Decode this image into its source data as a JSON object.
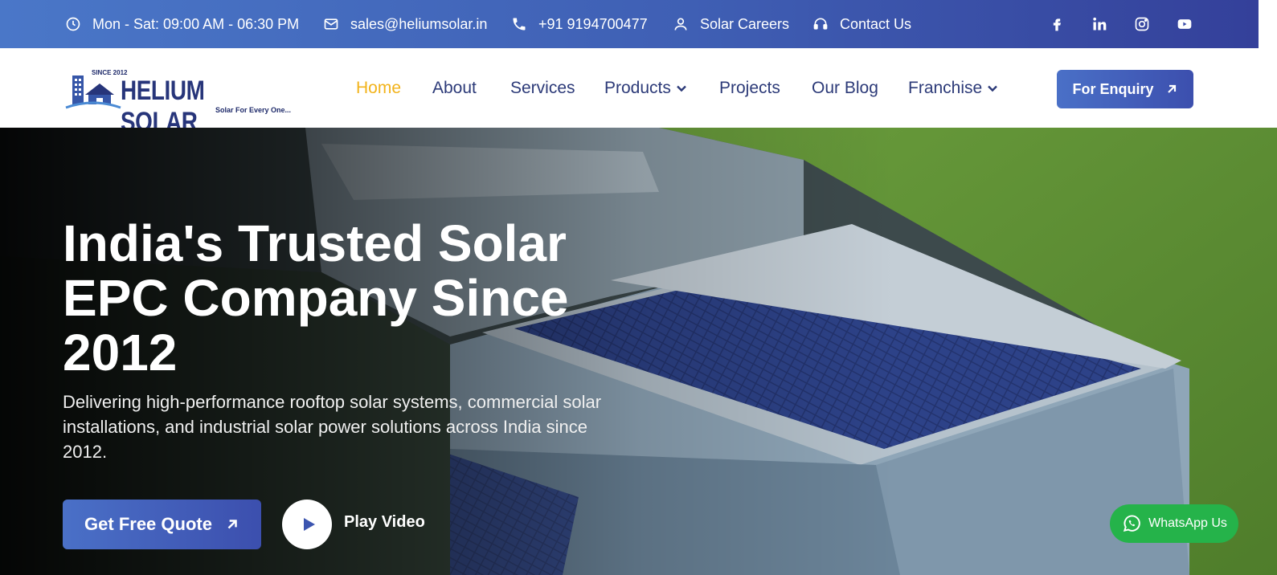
{
  "topbar": {
    "hours": "Mon - Sat: 09:00 AM - 06:30 PM",
    "email": "sales@heliumsolar.in",
    "phone": "+91 9194700477",
    "careers": "Solar Careers",
    "contact": "Contact Us",
    "socials": [
      "facebook-icon",
      "linkedin-icon",
      "instagram-icon",
      "youtube-icon"
    ]
  },
  "logo": {
    "since": "SINCE 2012",
    "name": "HELIUM SOLAR",
    "tagline": "Solar For Every One..."
  },
  "nav": {
    "items": [
      {
        "label": "Home",
        "active": true
      },
      {
        "label": "About"
      },
      {
        "label": "Services"
      },
      {
        "label": "Products",
        "dropdown": true
      },
      {
        "label": "Projects"
      },
      {
        "label": "Our Blog"
      },
      {
        "label": "Franchise",
        "dropdown": true
      }
    ],
    "enquiry_label": "For Enquiry"
  },
  "hero": {
    "title": "India's Trusted Solar EPC Company Since 2012",
    "subtitle": "Delivering high-performance rooftop solar systems, commercial solar installations, and industrial solar power solutions across India since 2012.",
    "quote_label": "Get Free Quote",
    "play_label": "Play Video"
  },
  "whatsapp_label": "WhatsApp Us",
  "colors": {
    "brand_blue": "#3c4fae",
    "accent_gold": "#f2b31b",
    "nav_text": "#2c3a78",
    "whatsapp_green": "#25b34a"
  }
}
